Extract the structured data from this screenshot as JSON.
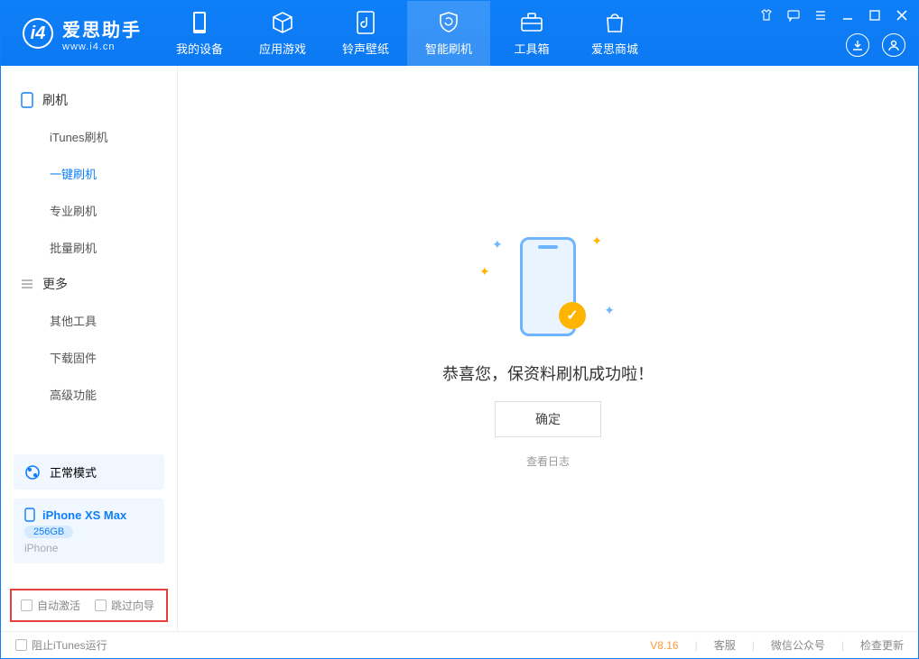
{
  "app": {
    "name_cn": "爱思助手",
    "name_en": "www.i4.cn"
  },
  "nav": {
    "items": [
      {
        "label": "我的设备"
      },
      {
        "label": "应用游戏"
      },
      {
        "label": "铃声壁纸"
      },
      {
        "label": "智能刷机"
      },
      {
        "label": "工具箱"
      },
      {
        "label": "爱思商城"
      }
    ]
  },
  "sidebar": {
    "group1": "刷机",
    "g1items": [
      "iTunes刷机",
      "一键刷机",
      "专业刷机",
      "批量刷机"
    ],
    "group2": "更多",
    "g2items": [
      "其他工具",
      "下载固件",
      "高级功能"
    ],
    "mode": "正常模式",
    "device": {
      "name": "iPhone XS Max",
      "storage": "256GB",
      "type": "iPhone"
    },
    "chk1": "自动激活",
    "chk2": "跳过向导"
  },
  "main": {
    "message": "恭喜您，保资料刷机成功啦！",
    "ok": "确定",
    "log": "查看日志"
  },
  "footer": {
    "block_itunes": "阻止iTunes运行",
    "version": "V8.16",
    "support": "客服",
    "wechat": "微信公众号",
    "update": "检查更新"
  }
}
